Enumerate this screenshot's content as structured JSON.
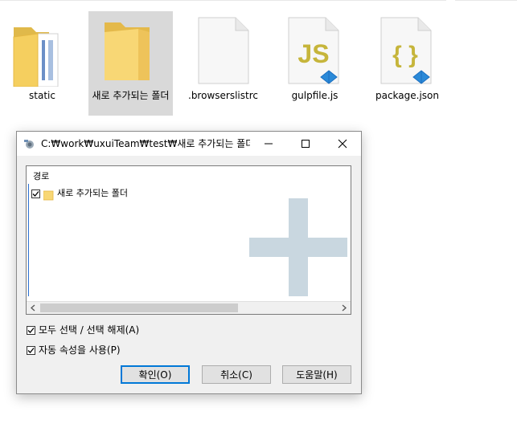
{
  "explorer": {
    "items": [
      {
        "name": "static",
        "icon": "folder-with-files-icon"
      },
      {
        "name": "새로 추가되는 폴더",
        "icon": "folder-icon",
        "selected": true
      },
      {
        "name": ".browserslistrc",
        "icon": "blank-file-icon"
      },
      {
        "name": "gulpfile.js",
        "icon": "js-file-icon",
        "badge": "JS"
      },
      {
        "name": "package.json",
        "icon": "json-file-icon",
        "badge": "{ }"
      }
    ]
  },
  "dialog": {
    "title": "C:₩work₩uxuiTeam₩test₩새로 추가되는 폴더 ...",
    "title_icon": "app-icon",
    "tree": {
      "header": "경로",
      "rows": [
        {
          "label": "새로 추가되는 폴더",
          "checked": true
        }
      ]
    },
    "options": [
      {
        "label": "모두 선택 / 선택 해제(A)",
        "checked": true
      },
      {
        "label": "자동 속성을 사용(P)",
        "checked": true
      }
    ],
    "buttons": {
      "ok": "확인(O)",
      "cancel": "취소(C)",
      "help": "도움말(H)"
    },
    "colors": {
      "accent": "#0078d7",
      "folder": "#f8d775",
      "plus": "#c9d7e0",
      "js_badge": "#c6b53b"
    }
  }
}
